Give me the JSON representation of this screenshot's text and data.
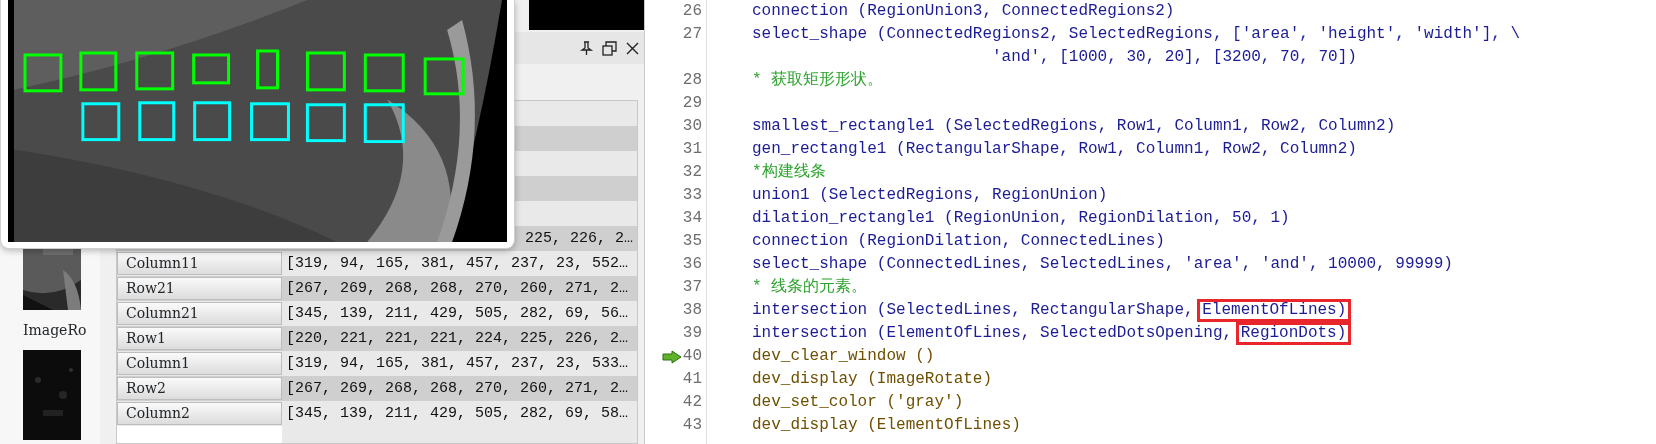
{
  "thumbnails": [
    {
      "label": "ImageRo"
    }
  ],
  "variables": [
    {
      "value": "225, 226, 2…"
    },
    {
      "name": "Column11",
      "value": "[319, 94, 165, 381, 457, 237, 23, 552…"
    },
    {
      "name": "Row21",
      "value": "[267, 269, 268, 268, 270, 260, 271, 2…"
    },
    {
      "name": "Column21",
      "value": "[345, 139, 211, 429, 505, 282, 69, 56…"
    },
    {
      "name": "Row1",
      "value": "[220, 221, 221, 221, 224, 225, 226, 2…"
    },
    {
      "name": "Column1",
      "value": "[319, 94, 165, 381, 457, 237, 23, 533…"
    },
    {
      "name": "Row2",
      "value": "[267, 269, 268, 268, 270, 260, 271, 2…"
    },
    {
      "name": "Column2",
      "value": "[345, 139, 211, 429, 505, 282, 69, 58…"
    }
  ],
  "code_lines": [
    {
      "number": "26",
      "kind": "operator",
      "current": false,
      "text": "connection (RegionUnion3, ConnectedRegions2)"
    },
    {
      "number": "27",
      "kind": "operator",
      "current": false,
      "text": "select_shape (ConnectedRegions2, SelectedRegions, ['area', 'height', 'width'], \\"
    },
    {
      "kind": "continuation",
      "current": false,
      "text": "'and', [1000, 30, 20], [3200, 70, 70])"
    },
    {
      "number": "28",
      "kind": "comment",
      "current": false,
      "text": "* 获取矩形形状。"
    },
    {
      "number": "29",
      "kind": "blank",
      "current": false
    },
    {
      "number": "30",
      "kind": "operator",
      "current": false,
      "text": "smallest_rectangle1 (SelectedRegions, Row1, Column1, Row2, Column2)"
    },
    {
      "number": "31",
      "kind": "operator",
      "current": false,
      "text": "gen_rectangle1 (RectangularShape, Row1, Column1, Row2, Column2)"
    },
    {
      "number": "32",
      "kind": "comment",
      "current": false,
      "text": "*构建线条"
    },
    {
      "number": "33",
      "kind": "operator",
      "current": false,
      "text": "union1 (SelectedRegions, RegionUnion)"
    },
    {
      "number": "34",
      "kind": "operator",
      "current": false,
      "text": "dilation_rectangle1 (RegionUnion, RegionDilation, 50, 1)"
    },
    {
      "number": "35",
      "kind": "operator",
      "current": false,
      "text": "connection (RegionDilation, ConnectedLines)"
    },
    {
      "number": "36",
      "kind": "operator",
      "current": false,
      "text": "select_shape (ConnectedLines, SelectedLines, 'area', 'and', 10000, 99999)"
    },
    {
      "number": "37",
      "kind": "comment",
      "current": false,
      "text": "* 线条的元素。"
    },
    {
      "number": "38",
      "kind": "operator",
      "current": false,
      "segments": [
        {
          "text": "intersection (SelectedLines, RectangularShape,",
          "boxed": false
        },
        {
          "text": "ElementOfLines)",
          "boxed": true
        }
      ]
    },
    {
      "number": "39",
      "kind": "operator",
      "current": false,
      "segments": [
        {
          "text": "intersection (ElementOfLines, SelectedDotsOpening,",
          "boxed": false
        },
        {
          "text": "RegionDots)",
          "boxed": true
        }
      ]
    },
    {
      "number": "40",
      "kind": "dev",
      "current": true,
      "text": "dev_clear_window ()"
    },
    {
      "number": "41",
      "kind": "dev",
      "current": false,
      "text": "dev_display (ImageRotate)"
    },
    {
      "number": "42",
      "kind": "dev",
      "current": false,
      "text": "dev_set_color ('gray')"
    },
    {
      "number": "43",
      "kind": "dev",
      "current": false,
      "text": "dev_display (ElementOfLines)"
    }
  ]
}
